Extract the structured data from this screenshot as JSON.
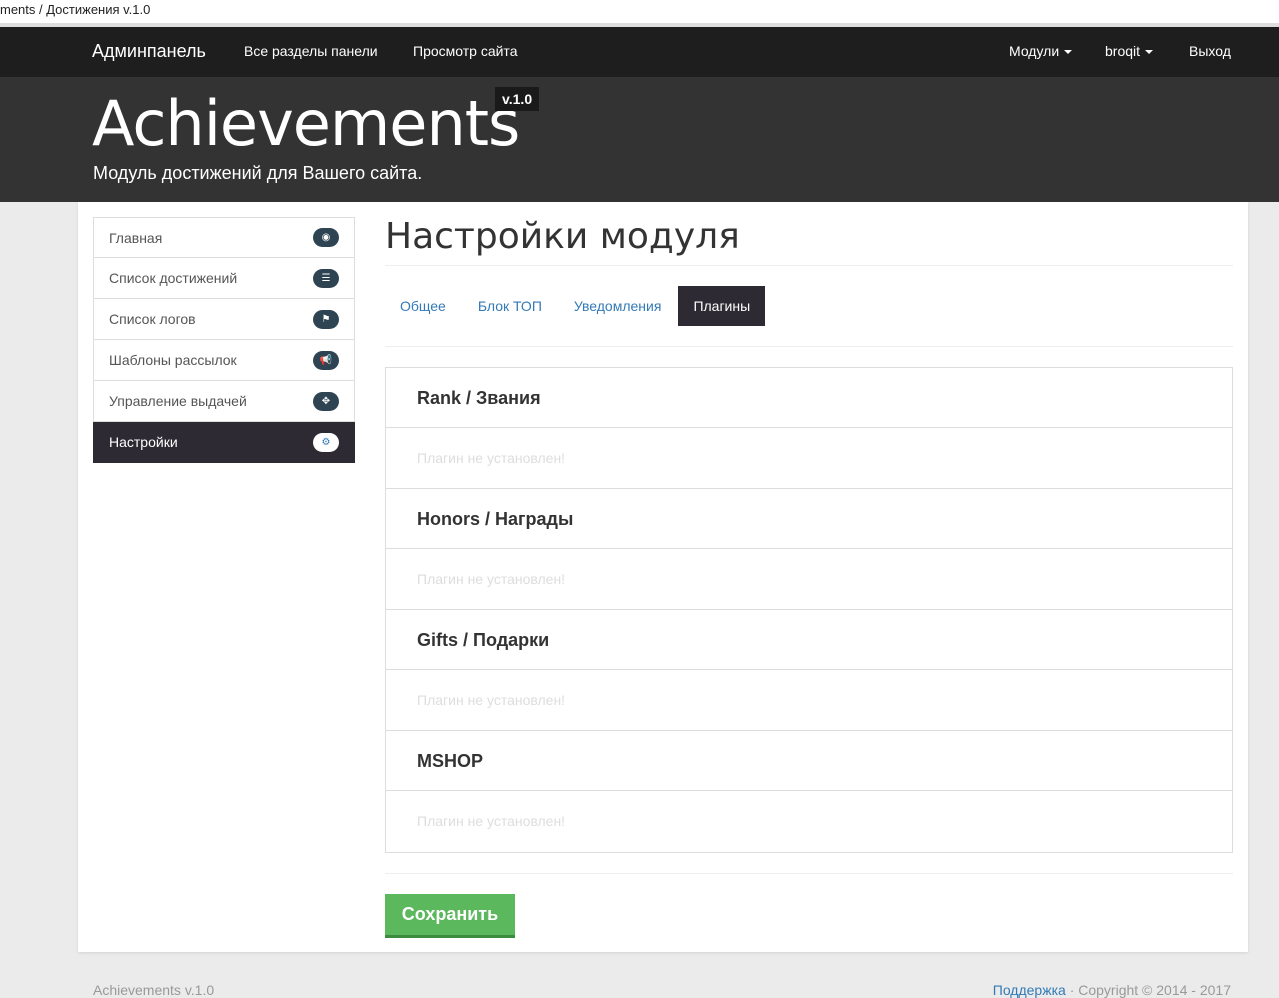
{
  "browser_tab": "ments / Достижения v.1.0",
  "nav": {
    "brand": "Админпанель",
    "all_sections": "Все разделы панели",
    "view_site": "Просмотр сайта",
    "modules": "Модули",
    "user": "broqit",
    "logout": "Выход"
  },
  "hero": {
    "title": "Achievements",
    "version": "v.1.0",
    "subtitle": "Модуль достижений для Вашего сайта."
  },
  "sidebar": {
    "items": [
      {
        "label": "Главная",
        "icon": "dashboard-icon",
        "glyph": "◉"
      },
      {
        "label": "Список достижений",
        "icon": "list-icon",
        "glyph": "☰"
      },
      {
        "label": "Список логов",
        "icon": "flag-icon",
        "glyph": "⚑"
      },
      {
        "label": "Шаблоны рассылок",
        "icon": "bullhorn-icon",
        "glyph": "📢"
      },
      {
        "label": "Управление выдачей",
        "icon": "crosshairs-icon",
        "glyph": "✥"
      },
      {
        "label": "Настройки",
        "icon": "gear-icon",
        "glyph": "⚙"
      }
    ]
  },
  "main": {
    "title": "Настройки модуля",
    "tabs": [
      "Общее",
      "Блок ТОП",
      "Уведомления",
      "Плагины"
    ],
    "plugins": [
      {
        "name": "Rank / Звания",
        "status": "Плагин не установлен!"
      },
      {
        "name": "Honors / Награды",
        "status": "Плагин не установлен!"
      },
      {
        "name": "Gifts / Подарки",
        "status": "Плагин не установлен!"
      },
      {
        "name": "MSHOP",
        "status": "Плагин не установлен!"
      }
    ],
    "save": "Сохранить"
  },
  "footer": {
    "left": "Achievements v.1.0",
    "support": "Поддержка",
    "copyright": " · Copyright © 2014 - 2017"
  }
}
